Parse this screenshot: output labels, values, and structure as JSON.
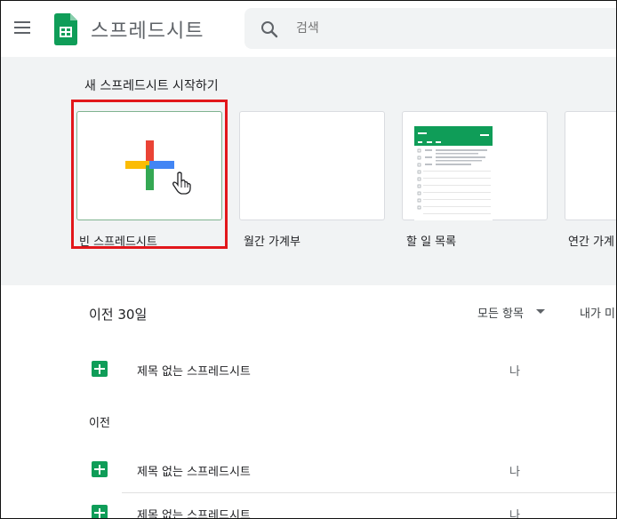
{
  "header": {
    "app_title": "스프레드시트",
    "search_placeholder": "검색"
  },
  "gallery": {
    "title": "새 스프레드시트 시작하기",
    "templates": [
      {
        "label": "빈 스프레드시트"
      },
      {
        "label": "월간 가계부"
      },
      {
        "label": "할 일 목록"
      },
      {
        "label": "연간 가계"
      }
    ]
  },
  "recent": {
    "title": "이전 30일",
    "filter_label": "모든 항목",
    "owner_header": "내가 미",
    "sections": [
      {
        "label": "",
        "files": [
          {
            "name": "제목 없는 스프레드시트",
            "owner": "나"
          }
        ]
      },
      {
        "label": "이전",
        "files": [
          {
            "name": "제목 없는 스프레드시트",
            "owner": "나"
          },
          {
            "name": "제목 없는 스프레드시트",
            "owner": "나"
          }
        ]
      }
    ]
  },
  "colors": {
    "sheets_green": "#0f9d58",
    "highlight_red": "#e2171b",
    "plus_red": "#ea4335",
    "plus_yellow": "#fbbc04",
    "plus_green": "#34a853",
    "plus_blue": "#4285f4"
  }
}
